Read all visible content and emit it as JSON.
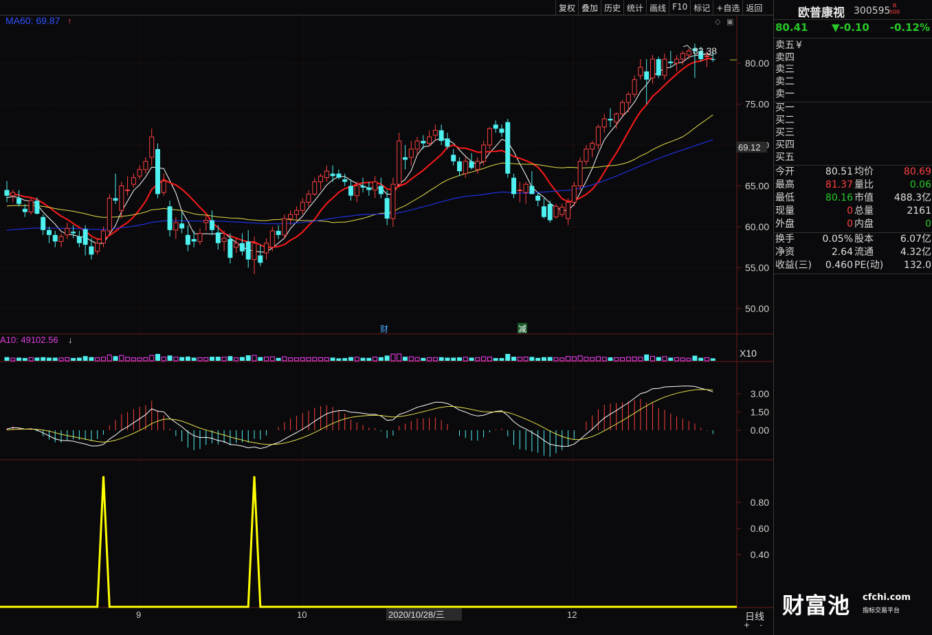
{
  "toolbar": {
    "items": [
      "复权",
      "叠加",
      "历史",
      "统计",
      "画线",
      "F10",
      "标记",
      "+自选",
      "返回"
    ]
  },
  "chart_header": {
    "ma_label": "MA60: 69.87",
    "ma_arrow": "↑",
    "vol_label": "A10: 49102.56",
    "vol_arrow": "↓",
    "vol_scale": "X10"
  },
  "markers": {
    "high_label": "82.38",
    "current_price_tag": "69.12",
    "event_cai": "财",
    "event_jian": "减"
  },
  "x_axis": {
    "labels": [
      "9",
      "10",
      "12"
    ],
    "cursor_date": "2020/10/28/三"
  },
  "period": "日线",
  "zoom": {
    "plus": "+",
    "minus": "-"
  },
  "stock": {
    "name": "欧普康视",
    "code": "300595",
    "badge_top": "R",
    "badge_bottom": "500",
    "price": "80.41",
    "change": "▼-0.10",
    "change_pct": "-0.12%",
    "currency": "¥"
  },
  "order_book": {
    "sell": [
      "卖五",
      "卖四",
      "卖三",
      "卖二",
      "卖一"
    ],
    "buy": [
      "买一",
      "买二",
      "买三",
      "买四",
      "买五"
    ]
  },
  "quote": [
    {
      "l1": "今开",
      "v1": "80.51",
      "c1": "white",
      "l2": "均价",
      "v2": "80.69",
      "c2": "red"
    },
    {
      "l1": "最高",
      "v1": "81.37",
      "c1": "red",
      "l2": "量比",
      "v2": "0.06",
      "c2": "green"
    },
    {
      "l1": "最低",
      "v1": "80.16",
      "c1": "green",
      "l2": "市值",
      "v2": "488.3亿",
      "c2": "white"
    },
    {
      "l1": "现量",
      "v1": "0",
      "c1": "red",
      "l2": "总量",
      "v2": "2161",
      "c2": "white"
    },
    {
      "l1": "外盘",
      "v1": "0",
      "c1": "red",
      "l2": "内盘",
      "v2": "0",
      "c2": "green"
    }
  ],
  "fundamentals": [
    {
      "l1": "换手",
      "v1": "0.05%",
      "l2": "股本",
      "v2": "6.07亿"
    },
    {
      "l1": "净资",
      "v1": "2.64",
      "l2": "流通",
      "v2": "4.32亿"
    },
    {
      "l1": "收益(三)",
      "v1": "0.460",
      "l2": "PE(动)",
      "v2": "132.0"
    }
  ],
  "logo": {
    "cn": "财富池",
    "en": "cfchi.com",
    "sub": "指标交易平台"
  },
  "colors": {
    "background": "#0a0a0c",
    "up": "#ff4040",
    "down": "#4ff0f0",
    "ma5": "#ffffff",
    "ma10": "#ff1a1a",
    "ma30": "#e6e04a",
    "ma60": "#2030e0",
    "signal": "#ffff00"
  },
  "chart_data": [
    {
      "type": "candlestick",
      "title": "MA60: 69.87",
      "ylim": [
        46,
        84
      ],
      "y_ticks": [
        50,
        55,
        60,
        65,
        70,
        75,
        80
      ],
      "x_labels": [
        "9",
        "10",
        "12"
      ],
      "candles_ohlc": [
        [
          64.5,
          65.6,
          63.0,
          63.8
        ],
        [
          63.8,
          64.5,
          63.0,
          64.2
        ],
        [
          63.5,
          64.5,
          62.5,
          62.8
        ],
        [
          62.2,
          62.8,
          61.2,
          61.8
        ],
        [
          61.8,
          63.5,
          61.5,
          63.2
        ],
        [
          63.2,
          63.6,
          61.5,
          61.6
        ],
        [
          61.2,
          61.5,
          59.0,
          59.6
        ],
        [
          59.6,
          60.0,
          58.0,
          59.0
        ],
        [
          59.0,
          59.5,
          57.5,
          58.2
        ],
        [
          58.2,
          59.2,
          57.5,
          58.8
        ],
        [
          59.0,
          60.5,
          58.5,
          59.8
        ],
        [
          59.4,
          60.2,
          58.6,
          59.2
        ],
        [
          58.8,
          59.5,
          57.5,
          58.0
        ],
        [
          59.7,
          60.2,
          56.5,
          57.8
        ],
        [
          57.6,
          58.6,
          56.0,
          56.6
        ],
        [
          57.0,
          58.6,
          56.6,
          58.0
        ],
        [
          58.0,
          60.0,
          57.5,
          59.5
        ],
        [
          59.5,
          64.0,
          59.0,
          63.5
        ],
        [
          63.5,
          66.5,
          62.8,
          63.2
        ],
        [
          62.0,
          65.5,
          61.0,
          65.0
        ],
        [
          64.5,
          66.2,
          63.8,
          64.5
        ],
        [
          65.2,
          66.5,
          64.8,
          66.0
        ],
        [
          66.2,
          67.5,
          65.8,
          67.0
        ],
        [
          67.0,
          68.5,
          66.5,
          68.0
        ],
        [
          68.5,
          72.0,
          67.5,
          71.0
        ],
        [
          69.5,
          70.2,
          63.5,
          64.0
        ],
        [
          64.2,
          66.5,
          63.8,
          65.6
        ],
        [
          62.5,
          63.2,
          58.8,
          59.6
        ],
        [
          59.6,
          61.2,
          58.5,
          60.5
        ],
        [
          60.4,
          61.8,
          59.2,
          59.8
        ],
        [
          59.0,
          60.2,
          57.0,
          57.8
        ],
        [
          58.5,
          59.5,
          57.5,
          58.2
        ],
        [
          58.2,
          59.8,
          57.8,
          59.2
        ],
        [
          60.5,
          61.5,
          59.5,
          60.8
        ],
        [
          60.8,
          62.0,
          59.0,
          59.6
        ],
        [
          59.3,
          60.2,
          57.2,
          58.0
        ],
        [
          58.2,
          59.5,
          57.0,
          58.6
        ],
        [
          58.5,
          59.2,
          55.5,
          56.2
        ],
        [
          57.5,
          58.6,
          56.8,
          58.0
        ],
        [
          58.0,
          59.2,
          56.5,
          57.0
        ],
        [
          58.2,
          59.6,
          55.0,
          56.0
        ],
        [
          56.0,
          58.8,
          54.2,
          58.0
        ],
        [
          56.5,
          57.8,
          55.2,
          55.6
        ],
        [
          56.8,
          58.6,
          56.0,
          58.0
        ],
        [
          57.5,
          60.0,
          57.0,
          59.5
        ],
        [
          59.5,
          60.2,
          58.5,
          59.0
        ],
        [
          59.0,
          61.5,
          58.5,
          61.0
        ],
        [
          61.0,
          62.0,
          60.2,
          61.5
        ],
        [
          61.5,
          62.5,
          60.8,
          62.0
        ],
        [
          62.0,
          63.5,
          61.5,
          63.0
        ],
        [
          63.0,
          64.5,
          62.5,
          64.0
        ],
        [
          64.0,
          66.0,
          63.8,
          65.5
        ],
        [
          65.5,
          66.5,
          64.5,
          66.2
        ],
        [
          66.0,
          67.5,
          65.5,
          66.8
        ],
        [
          66.5,
          67.5,
          65.5,
          66.2
        ],
        [
          66.5,
          67.0,
          65.8,
          66.0
        ],
        [
          65.8,
          66.5,
          65.0,
          65.5
        ],
        [
          65.0,
          65.8,
          63.2,
          63.8
        ],
        [
          63.8,
          65.5,
          63.0,
          65.0
        ],
        [
          65.0,
          66.0,
          64.2,
          64.8
        ],
        [
          64.8,
          65.5,
          63.8,
          64.5
        ],
        [
          64.5,
          66.2,
          63.5,
          65.5
        ],
        [
          65.0,
          66.0,
          63.5,
          64.0
        ],
        [
          63.5,
          64.5,
          60.2,
          61.0
        ],
        [
          61.0,
          66.0,
          60.0,
          65.2
        ],
        [
          65.2,
          71.5,
          64.8,
          70.5
        ],
        [
          68.5,
          70.0,
          67.0,
          68.2
        ],
        [
          68.5,
          70.5,
          67.5,
          69.5
        ],
        [
          69.5,
          71.0,
          68.8,
          70.5
        ],
        [
          70.5,
          71.2,
          69.5,
          70.2
        ],
        [
          70.2,
          71.8,
          69.8,
          71.0
        ],
        [
          71.2,
          72.5,
          70.5,
          71.8
        ],
        [
          71.8,
          72.5,
          70.0,
          70.5
        ],
        [
          70.8,
          71.5,
          69.5,
          69.8
        ],
        [
          68.8,
          69.5,
          67.5,
          68.0
        ],
        [
          68.0,
          68.5,
          66.2,
          66.8
        ],
        [
          66.5,
          68.5,
          66.0,
          68.0
        ],
        [
          68.0,
          69.0,
          67.0,
          67.2
        ],
        [
          67.0,
          68.5,
          66.5,
          68.0
        ],
        [
          68.0,
          70.5,
          67.5,
          70.0
        ],
        [
          70.0,
          72.2,
          69.5,
          72.0
        ],
        [
          72.5,
          73.0,
          71.5,
          72.0
        ],
        [
          72.0,
          72.5,
          71.0,
          71.5
        ],
        [
          72.8,
          73.2,
          66.0,
          66.5
        ],
        [
          66.0,
          66.5,
          63.5,
          64.0
        ],
        [
          64.5,
          65.5,
          63.0,
          64.5
        ],
        [
          64.2,
          65.5,
          62.8,
          65.2
        ],
        [
          65.0,
          66.8,
          64.0,
          64.0
        ],
        [
          63.8,
          64.2,
          62.5,
          63.2
        ],
        [
          62.5,
          63.5,
          61.0,
          61.2
        ],
        [
          62.8,
          63.2,
          60.5,
          60.8
        ],
        [
          61.2,
          62.8,
          61.0,
          62.5
        ],
        [
          61.5,
          62.8,
          61.2,
          62.4
        ],
        [
          61.0,
          63.5,
          60.2,
          63.0
        ],
        [
          63.0,
          65.5,
          62.5,
          65.0
        ],
        [
          65.0,
          68.5,
          64.5,
          68.0
        ],
        [
          68.0,
          70.0,
          67.5,
          69.5
        ],
        [
          69.5,
          70.5,
          68.5,
          70.2
        ],
        [
          70.0,
          72.5,
          69.5,
          72.2
        ],
        [
          72.2,
          73.8,
          71.5,
          73.2
        ],
        [
          73.2,
          74.5,
          72.2,
          73.0
        ],
        [
          72.8,
          74.0,
          72.0,
          73.8
        ],
        [
          73.8,
          75.5,
          73.5,
          75.2
        ],
        [
          75.2,
          76.5,
          74.0,
          76.2
        ],
        [
          76.2,
          78.5,
          75.8,
          78.0
        ],
        [
          78.5,
          80.5,
          78.0,
          79.5
        ],
        [
          79.0,
          80.5,
          75.0,
          78.0
        ],
        [
          78.2,
          81.0,
          77.5,
          80.5
        ],
        [
          80.5,
          80.8,
          78.2,
          78.5
        ],
        [
          78.5,
          81.2,
          78.0,
          80.5
        ],
        [
          80.2,
          81.5,
          79.5,
          80.0
        ],
        [
          80.0,
          81.0,
          79.0,
          80.5
        ],
        [
          80.5,
          81.5,
          79.8,
          81.2
        ],
        [
          81.0,
          81.8,
          80.5,
          81.5
        ],
        [
          81.8,
          82.4,
          78.2,
          81.5
        ],
        [
          81.5,
          82.0,
          80.2,
          80.5
        ],
        [
          80.8,
          81.5,
          79.5,
          80.9
        ],
        [
          80.51,
          81.37,
          80.16,
          80.41
        ]
      ]
    },
    {
      "type": "bar",
      "title": "A10: 49102.56",
      "scale": "X10"
    },
    {
      "type": "line",
      "title": "MACD",
      "y_ticks": [
        0.0,
        1.5,
        3.0
      ],
      "ylim": [
        -2.2,
        4.2
      ]
    },
    {
      "type": "line",
      "title": "signal",
      "y_ticks": [
        0.8,
        0.6,
        0.4
      ],
      "ylim": [
        0,
        1
      ],
      "spikes_at_candle_index": [
        16,
        41
      ],
      "spike_value": 1
    }
  ]
}
